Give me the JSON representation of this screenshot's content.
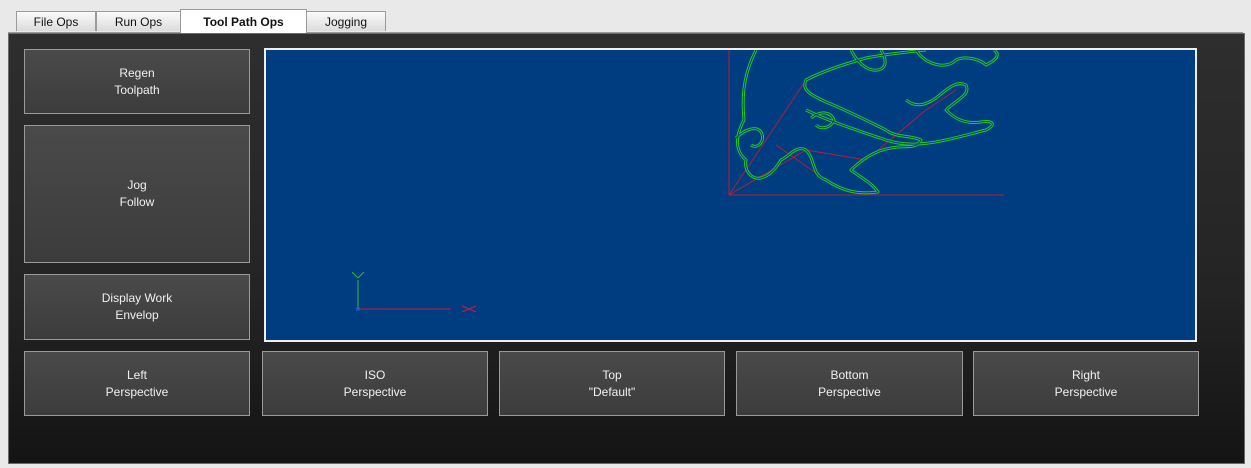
{
  "tabs": [
    {
      "label": "File Ops",
      "active": false
    },
    {
      "label": "Run Ops",
      "active": false
    },
    {
      "label": "Tool Path Ops",
      "active": true
    },
    {
      "label": "Jogging",
      "active": false
    }
  ],
  "side_buttons": {
    "regen": "Regen\nToolpath",
    "jog_follow": "Jog\nFollow",
    "display_work": "Display Work\nEnvelop"
  },
  "view_buttons": {
    "left": "Left\nPerspective",
    "iso": "ISO\nPerspective",
    "top": "Top\n\"Default\"",
    "bottom": "Bottom\nPerspective",
    "right": "Right\nPerspective"
  },
  "colors": {
    "viewport_bg": "#003c80",
    "toolpath": "#22cc22",
    "work_envelope": "#b0203a",
    "axis_x": "#c02040",
    "axis_y": "#20c040",
    "axis_z": "#2050ff"
  }
}
